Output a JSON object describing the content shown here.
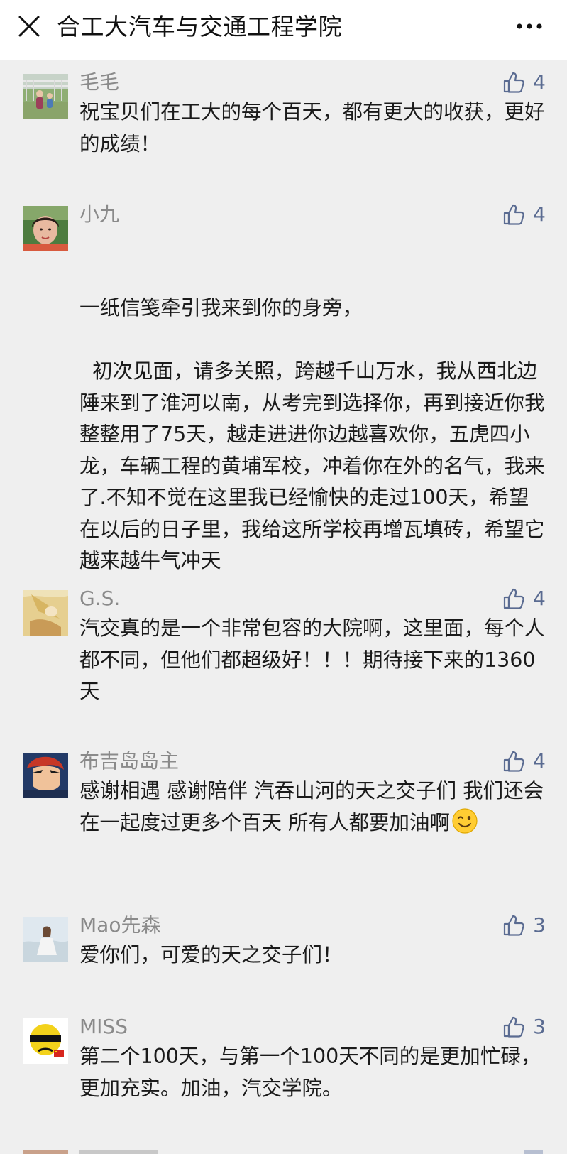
{
  "header": {
    "title": "合工大汽车与交通工程学院",
    "close_icon": "close-icon",
    "more_icon": "more-icon"
  },
  "colors": {
    "nickname": "#8a8a8a",
    "like_accent": "#5a6b91",
    "background": "#efefef"
  },
  "comments": [
    {
      "nickname": "毛毛",
      "likes": "4",
      "content": "祝宝贝们在工大的每个百天，都有更大的收获，更好的成绩！"
    },
    {
      "nickname": "小九",
      "likes": "4",
      "content": "一纸信笺牵引我来到你的身旁，\n\n  初次见面，请多关照，跨越千山万水，我从西北边陲来到了淮河以南，从考完到选择你，再到接近你我整整用了75天，越走进进你边越喜欢你，五虎四小龙，车辆工程的黄埔军校，冲着你在外的名气，我来了.不知不觉在这里我已经愉快的走过100天，希望在以后的日子里，我给这所学校再增瓦填砖，希望它越来越牛气冲天"
    },
    {
      "nickname": "G.S.",
      "likes": "4",
      "content": "汽交真的是一个非常包容的大院啊，这里面，每个人都不同，但他们都超级好！！！期待接下来的1360天"
    },
    {
      "nickname": "布吉岛岛主",
      "likes": "4",
      "content": "感谢相遇 感谢陪伴 汽吞山河的天之交子们 我们还会在一起度过更多个百天 所有人都要加油啊",
      "emoji": "wink-emoji"
    },
    {
      "nickname": "Mao先森",
      "likes": "3",
      "content": "爱你们，可爱的天之交子们！"
    },
    {
      "nickname": "MISS",
      "likes": "3",
      "content": "第二个100天，与第一个100天不同的是更加忙碌，更加充实。加油，汽交学院。"
    }
  ]
}
